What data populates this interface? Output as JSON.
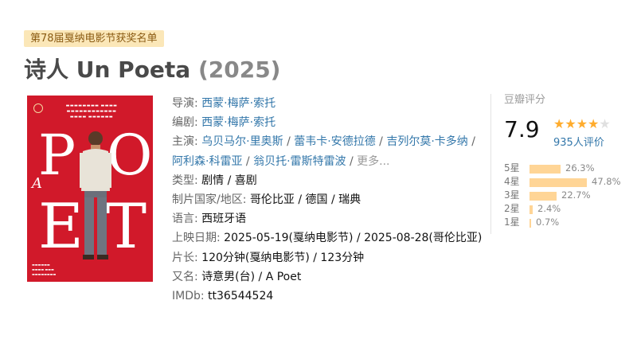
{
  "award_tag": "第78届戛纳电影节获奖名单",
  "title": {
    "main": "诗人 Un Poeta",
    "year": "(2025)"
  },
  "poster": {
    "letters": [
      "P",
      "O",
      "A",
      "E",
      "T"
    ],
    "colors": {
      "background": "#d1192a",
      "text": "#ffffff"
    }
  },
  "info": {
    "director_label": "导演:",
    "director": "西蒙·梅萨·索托",
    "writer_label": "编剧:",
    "writer": "西蒙·梅萨·索托",
    "cast_label": "主演:",
    "cast": [
      "乌贝马尔·里奥斯",
      "蕾韦卡·安德拉德",
      "吉列尔莫·卡多纳",
      "阿利森·科雷亚",
      "翁贝托·雷斯特雷波"
    ],
    "cast_more": "更多...",
    "genre_label": "类型:",
    "genres": [
      "剧情",
      "喜剧"
    ],
    "country_label": "制片国家/地区:",
    "countries": [
      "哥伦比亚",
      "德国",
      "瑞典"
    ],
    "language_label": "语言:",
    "language": "西班牙语",
    "release_label": "上映日期:",
    "release": "2025-05-19(戛纳电影节) / 2025-08-28(哥伦比亚)",
    "runtime_label": "片长:",
    "runtime": "120分钟(戛纳电影节) / 123分钟",
    "aka_label": "又名:",
    "aka": "诗意男(台) / A Poet",
    "imdb_label": "IMDb:",
    "imdb": "tt36544524"
  },
  "rating": {
    "header": "豆瓣评分",
    "score": "7.9",
    "stars_filled": 4,
    "stars_total": 5,
    "count": "935人评价",
    "colors": {
      "star": "#ffac2d",
      "star_empty": "#e0e0e0",
      "bar": "#ffd596"
    },
    "distribution": [
      {
        "label": "5星",
        "pct": "26.3%",
        "value": 26.3
      },
      {
        "label": "4星",
        "pct": "47.8%",
        "value": 47.8
      },
      {
        "label": "3星",
        "pct": "22.7%",
        "value": 22.7
      },
      {
        "label": "2星",
        "pct": "2.4%",
        "value": 2.4
      },
      {
        "label": "1星",
        "pct": "0.7%",
        "value": 0.7
      }
    ]
  }
}
